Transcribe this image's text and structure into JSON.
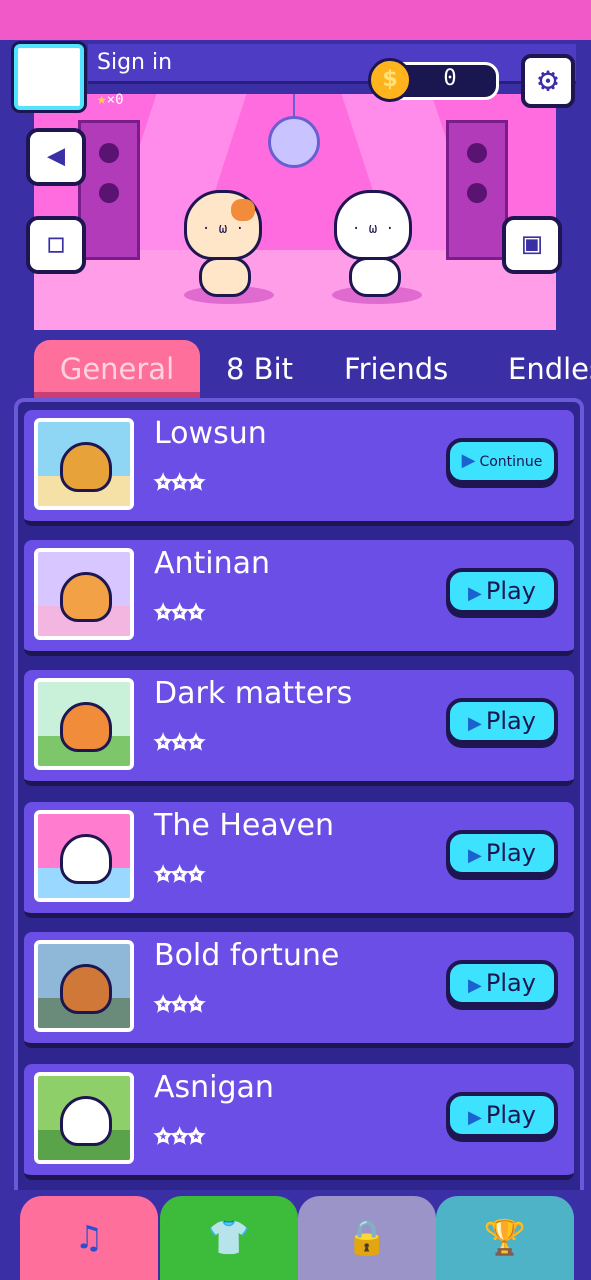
{
  "header": {
    "signin_label": "Sign in",
    "star_count": "×0",
    "coins": "0",
    "coin_symbol": "$"
  },
  "icons": {
    "back": "◀",
    "calendar": "◻",
    "gift": "▣",
    "settings": "⚙"
  },
  "tabs": [
    {
      "label": "General",
      "active": true
    },
    {
      "label": "8 Bit",
      "active": false
    },
    {
      "label": "Friends",
      "active": false
    },
    {
      "label": "Endles",
      "active": false
    }
  ],
  "songs": [
    {
      "title": "Lowsun",
      "rating": "✩✩✩",
      "button": "Continue"
    },
    {
      "title": "Antinan",
      "rating": "✩✩✩",
      "button": "Play"
    },
    {
      "title": "Dark matters",
      "rating": "✩✩✩",
      "button": "Play"
    },
    {
      "title": "The Heaven",
      "rating": "✩✩✩",
      "button": "Play"
    },
    {
      "title": "Bold fortune",
      "rating": "✩✩✩",
      "button": "Play"
    },
    {
      "title": "Asnigan",
      "rating": "✩✩✩",
      "button": "Play"
    }
  ],
  "bottom_nav": [
    {
      "icon": "♫",
      "name": "songs",
      "color": "#ff6f9b",
      "active": true
    },
    {
      "icon": "👕",
      "name": "costumes",
      "color": "#3dbb3a",
      "active": false
    },
    {
      "icon": "🔒",
      "name": "locked",
      "color": "#9a94c8",
      "active": false
    },
    {
      "icon": "🏆",
      "name": "trophies",
      "color": "#4fb3c8",
      "active": false
    }
  ],
  "colors": {
    "accent_tab": "#ff6f9b",
    "play_button": "#3de2ff",
    "stage_pink": "#ff6ce0",
    "frame_purple": "#3b2fa6"
  }
}
